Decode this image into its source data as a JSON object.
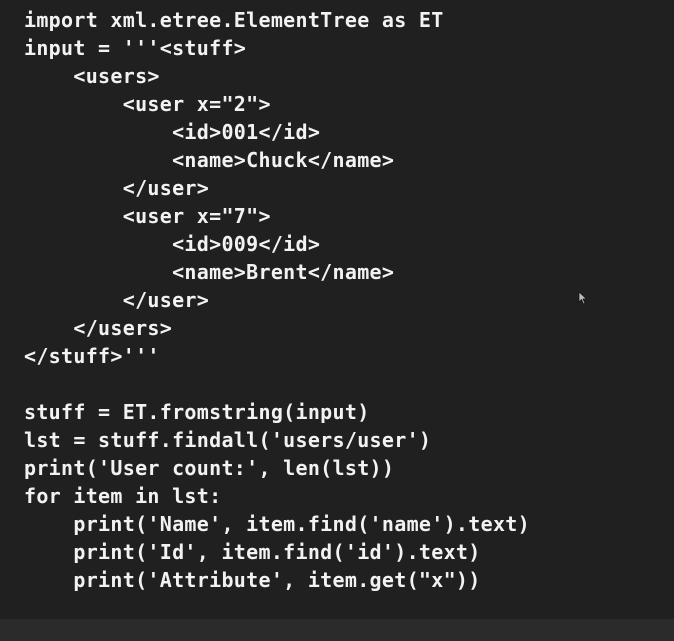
{
  "code": {
    "lines": [
      "import xml.etree.ElementTree as ET",
      "input = '''<stuff>",
      "    <users>",
      "        <user x=\"2\">",
      "            <id>001</id>",
      "            <name>Chuck</name>",
      "        </user>",
      "        <user x=\"7\">",
      "            <id>009</id>",
      "            <name>Brent</name>",
      "        </user>",
      "    </users>",
      "</stuff>'''",
      "",
      "stuff = ET.fromstring(input)",
      "lst = stuff.findall('users/user')",
      "print('User count:', len(lst))",
      "for item in lst:",
      "    print('Name', item.find('name').text)",
      "    print('Id', item.find('id').text)",
      "    print('Attribute', item.get(\"x\"))"
    ]
  },
  "colors": {
    "background": "#202020",
    "text": "#f2f2f2"
  },
  "icons": {
    "cursor": "mouse-pointer-icon"
  }
}
